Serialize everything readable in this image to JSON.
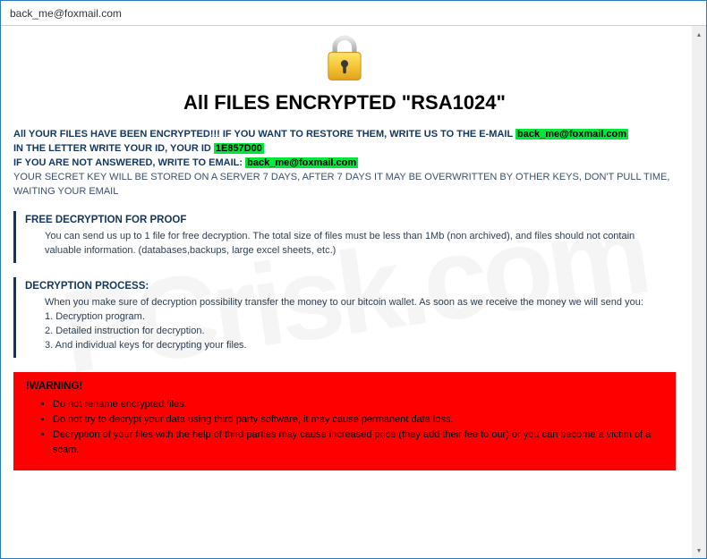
{
  "window": {
    "title": "back_me@foxmail.com"
  },
  "headline": "All FILES ENCRYPTED \"RSA1024\"",
  "intro": {
    "line1_a": "All YOUR FILES HAVE BEEN ENCRYPTED!!! IF YOU WANT TO RESTORE THEM, WRITE US TO THE E-MAIL ",
    "email1": "back_me@foxmail.com",
    "line2_a": "IN THE LETTER WRITE YOUR ID, YOUR ID ",
    "id": "1E857D00",
    "line3_a": "IF YOU ARE NOT ANSWERED, WRITE TO EMAIL: ",
    "email2": "back_me@foxmail.com",
    "line4": "YOUR SECRET KEY WILL BE STORED ON A SERVER 7 DAYS, AFTER 7 DAYS IT MAY BE OVERWRITTEN BY OTHER KEYS, DON'T PULL TIME, WAITING YOUR EMAIL"
  },
  "proof": {
    "title": "FREE DECRYPTION FOR PROOF",
    "body": "You can send us up to 1 file for free decryption. The total size of files must be less than 1Mb (non archived), and files should not contain valuable information. (databases,backups, large excel sheets, etc.)"
  },
  "process": {
    "title": "DECRYPTION PROCESS:",
    "lead": "When you make sure of decryption possibility transfer the money to our bitcoin wallet. As soon as we receive the money we will send you:",
    "s1": "1. Decryption program.",
    "s2": "2. Detailed instruction for decryption.",
    "s3": "3. And individual keys for decrypting your files."
  },
  "warning": {
    "title": "!WARNING!",
    "w1": "Do not rename encrypted files.",
    "w2": "Do not try to decrypt your data using third party software, it may cause permanent data loss.",
    "w3": "Decryption of your files with the help of third parties may cause increased price (they add their fee to our) or you can become a victim of a scam."
  },
  "watermark": "PCrisk.com"
}
